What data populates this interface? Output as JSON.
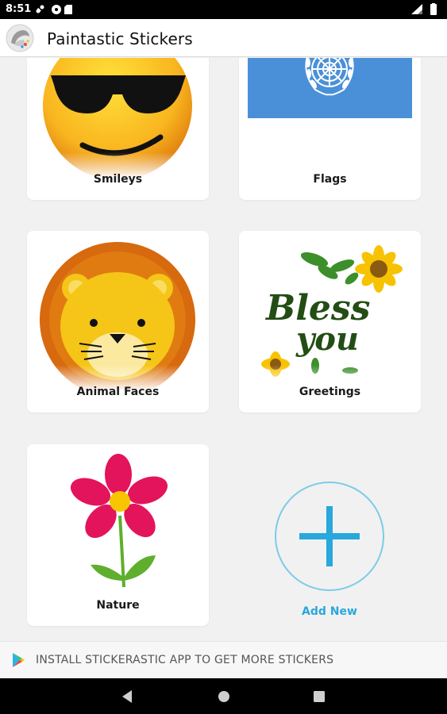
{
  "status_bar": {
    "time": "8:51"
  },
  "app_bar": {
    "title": "Paintastic Stickers"
  },
  "categories": [
    {
      "label": "Smileys"
    },
    {
      "label": "Flags"
    },
    {
      "label": "Animal Faces"
    },
    {
      "label": "Greetings"
    },
    {
      "label": "Nature"
    }
  ],
  "greeting_art": {
    "line1": "Bless",
    "line2": "you"
  },
  "add_new": {
    "label": "Add New"
  },
  "install_bar": {
    "text": "INSTALL STICKERASTIC APP TO GET MORE STICKERS"
  },
  "icons": {
    "status_left": [
      "notification-icon",
      "sync-icon",
      "game-icon",
      "sd-card-icon"
    ],
    "status_right": [
      "wifi-icon",
      "battery-icon"
    ],
    "nav": [
      "back-icon",
      "home-icon",
      "recents-icon"
    ]
  },
  "colors": {
    "accent": "#28a8dc",
    "flag_blue": "#4a90d9",
    "background": "#f1f1f1"
  }
}
